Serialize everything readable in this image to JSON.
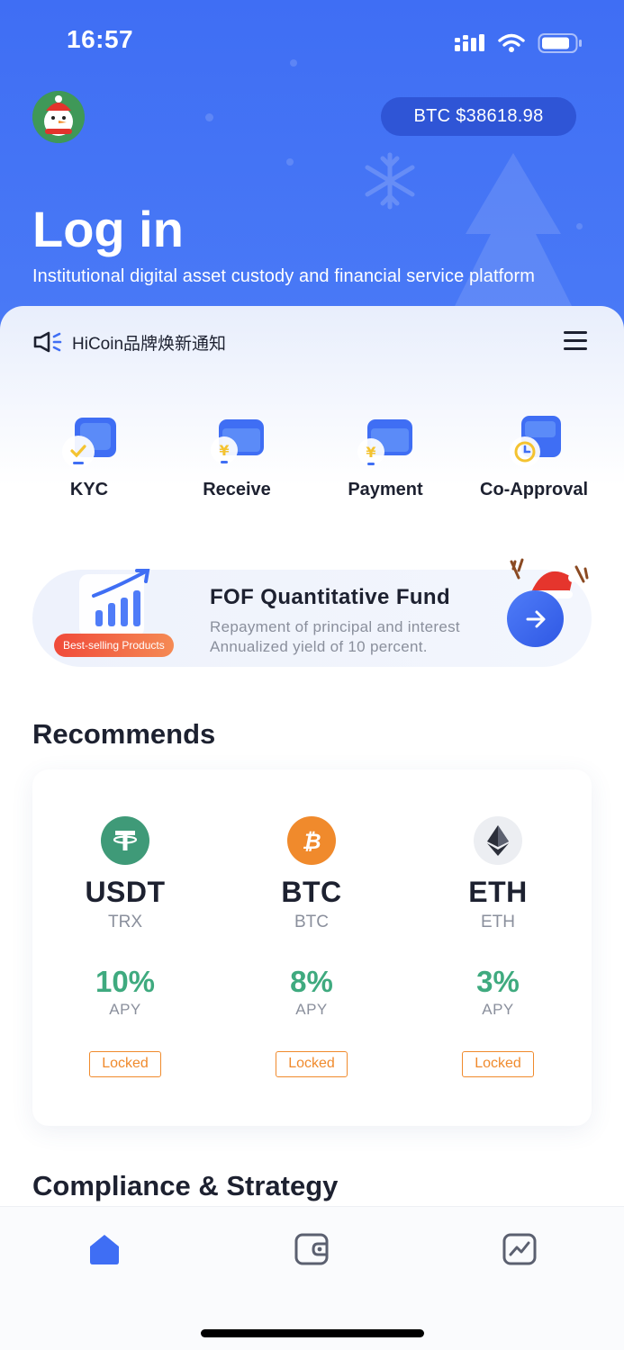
{
  "status_bar": {
    "time": "16:57",
    "icons": [
      "signal-icon",
      "wifi-icon",
      "battery-icon"
    ]
  },
  "header": {
    "btc_price": "BTC $38618.98",
    "title": "Log in",
    "subtitle": "Institutional digital asset custody and financial service platform"
  },
  "notice": {
    "text": "HiCoin品牌焕新通知",
    "icon": "speaker-icon"
  },
  "actions": [
    {
      "label": "KYC",
      "icon": "kyc-icon"
    },
    {
      "label": "Receive",
      "icon": "receive-icon"
    },
    {
      "label": "Payment",
      "icon": "payment-icon"
    },
    {
      "label": "Co-Approval",
      "icon": "co-approval-icon"
    }
  ],
  "fund": {
    "badge": "Best-selling Products",
    "title": "FOF Quantitative Fund",
    "line1": "Repayment of principal and interest",
    "line2": "Annualized yield of 10 percent."
  },
  "recommends": {
    "title": "Recommends",
    "items": [
      {
        "symbol": "USDT",
        "network": "TRX",
        "apy": "10%",
        "apy_label": "APY",
        "tag": "Locked",
        "color": "#3f9a78"
      },
      {
        "symbol": "BTC",
        "network": "BTC",
        "apy": "8%",
        "apy_label": "APY",
        "tag": "Locked",
        "color": "#f08a2c"
      },
      {
        "symbol": "ETH",
        "network": "ETH",
        "apy": "3%",
        "apy_label": "APY",
        "tag": "Locked",
        "color": "#e9ebef"
      }
    ]
  },
  "compliance": {
    "title": "Compliance & Strategy"
  },
  "tabbar": {
    "tabs": [
      "home-icon",
      "wallet-icon",
      "chart-icon"
    ],
    "active": "home-icon"
  },
  "colors": {
    "primary": "#3f6ef4",
    "accent_green": "#3faa7f",
    "accent_orange": "#f08a2c"
  }
}
